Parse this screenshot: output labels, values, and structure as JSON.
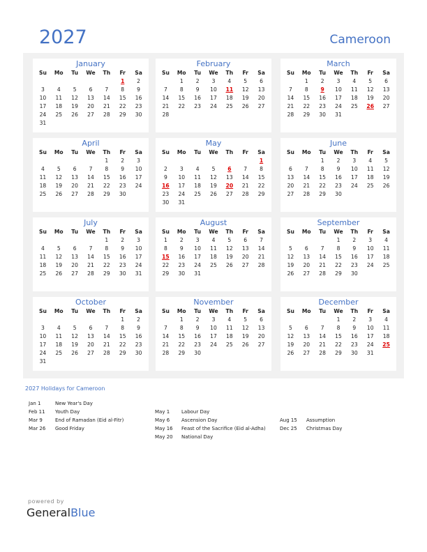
{
  "header": {
    "year": "2027",
    "country": "Cameroon"
  },
  "weekdays": [
    "Su",
    "Mo",
    "Tu",
    "We",
    "Th",
    "Fr",
    "Sa"
  ],
  "months": [
    {
      "name": "January",
      "start": 5,
      "days": 31,
      "holidays": [
        1
      ]
    },
    {
      "name": "February",
      "start": 1,
      "days": 28,
      "holidays": [
        11
      ]
    },
    {
      "name": "March",
      "start": 1,
      "days": 31,
      "holidays": [
        9,
        26
      ]
    },
    {
      "name": "April",
      "start": 4,
      "days": 30,
      "holidays": []
    },
    {
      "name": "May",
      "start": 6,
      "days": 31,
      "holidays": [
        1,
        6,
        16,
        20
      ]
    },
    {
      "name": "June",
      "start": 2,
      "days": 30,
      "holidays": []
    },
    {
      "name": "July",
      "start": 4,
      "days": 31,
      "holidays": []
    },
    {
      "name": "August",
      "start": 0,
      "days": 31,
      "holidays": [
        15
      ]
    },
    {
      "name": "September",
      "start": 3,
      "days": 30,
      "holidays": []
    },
    {
      "name": "October",
      "start": 5,
      "days": 31,
      "holidays": []
    },
    {
      "name": "November",
      "start": 1,
      "days": 30,
      "holidays": []
    },
    {
      "name": "December",
      "start": 3,
      "days": 31,
      "holidays": [
        25
      ]
    }
  ],
  "holidays_title": "2027 Holidays for Cameroon",
  "holiday_columns": [
    [
      {
        "date": "Jan 1",
        "name": "New Year's Day"
      },
      {
        "date": "Feb 11",
        "name": "Youth Day"
      },
      {
        "date": "Mar 9",
        "name": "End of Ramadan (Eid al-Fitr)"
      },
      {
        "date": "Mar 26",
        "name": "Good Friday"
      }
    ],
    [
      {
        "date": "",
        "name": ""
      },
      {
        "date": "May 1",
        "name": "Labour Day"
      },
      {
        "date": "May 6",
        "name": "Ascension Day"
      },
      {
        "date": "May 16",
        "name": "Feast of the Sacrifice (Eid al-Adha)"
      },
      {
        "date": "May 20",
        "name": "National Day"
      }
    ],
    [
      {
        "date": "",
        "name": ""
      },
      {
        "date": "",
        "name": ""
      },
      {
        "date": "Aug 15",
        "name": "Assumption"
      },
      {
        "date": "Dec 25",
        "name": "Christmas Day"
      }
    ]
  ],
  "footer": {
    "powered_by": "powered by",
    "brand_general": "General",
    "brand_blue": "Blue"
  },
  "colors": {
    "accent": "#4472c4",
    "holiday": "#dd0000",
    "panel": "#f1f1f1"
  }
}
